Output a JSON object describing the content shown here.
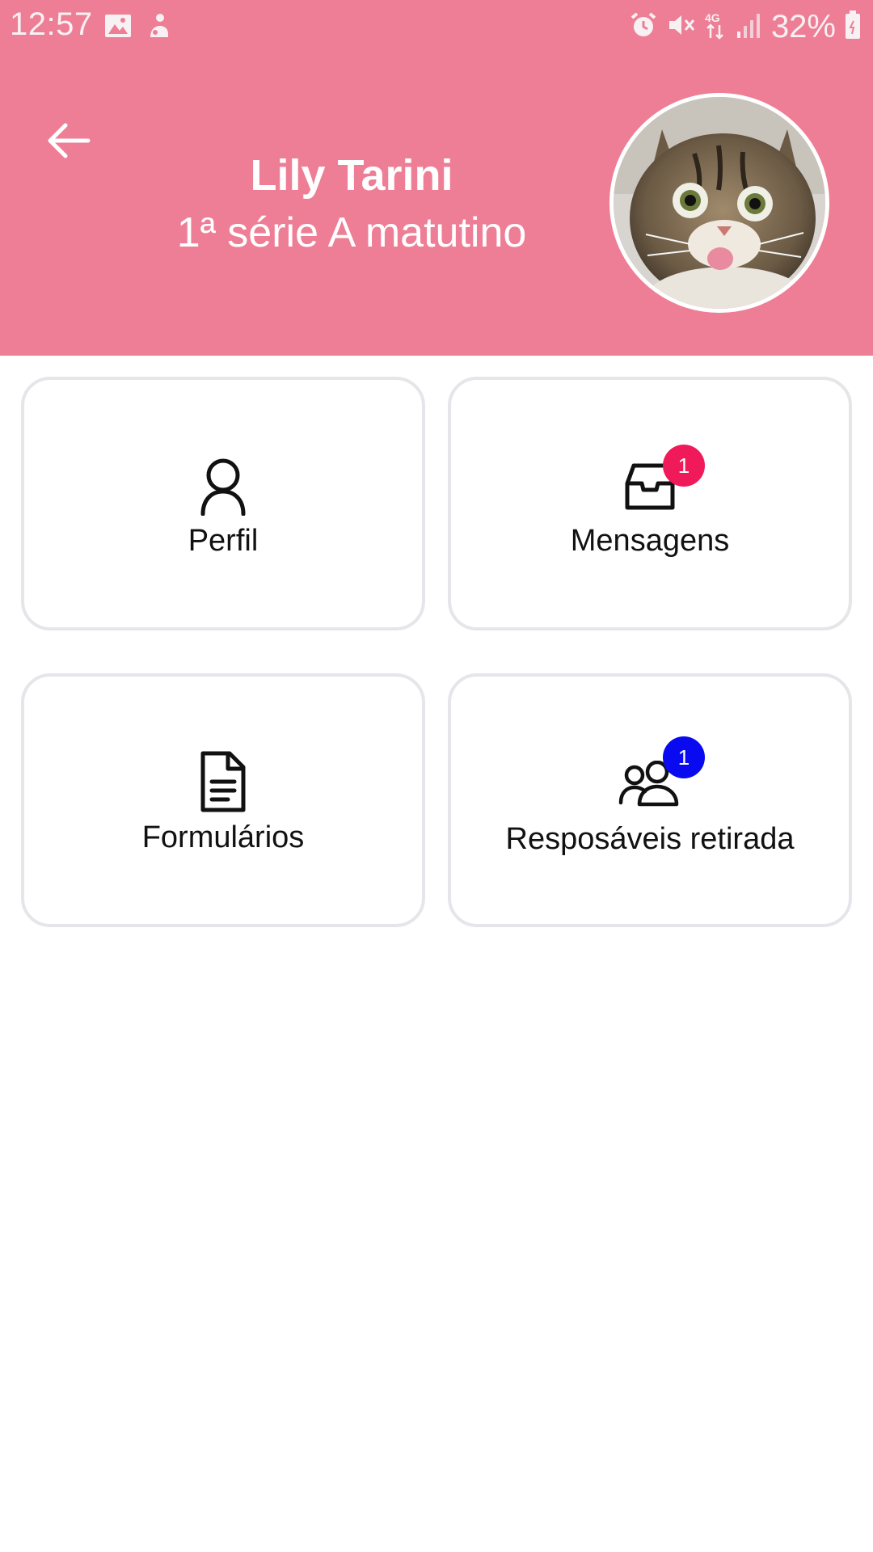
{
  "status_bar": {
    "time": "12:57",
    "battery": "32%",
    "left_icons": [
      "image-icon",
      "notification-app-icon"
    ],
    "right_icons": [
      "alarm-icon",
      "mute-icon",
      "network-4g-icon",
      "signal-icon",
      "battery-icon"
    ]
  },
  "header": {
    "background_color": "#EE7E96",
    "back_icon": "arrow-left-icon",
    "name": "Lily Tarini",
    "class_label": "1ª série A matutino",
    "avatar": "cat-photo-avatar"
  },
  "menu": {
    "items": [
      {
        "label": "Perfil",
        "icon": "user-icon",
        "badge": null
      },
      {
        "label": "Mensagens",
        "icon": "inbox-icon",
        "badge": "1",
        "badge_color": "#F0195A"
      },
      {
        "label": "Formulários",
        "icon": "document-icon",
        "badge": null
      },
      {
        "label": "Resposáveis retirada",
        "icon": "users-icon",
        "badge": "1",
        "badge_color": "#0A0AF0"
      }
    ]
  }
}
